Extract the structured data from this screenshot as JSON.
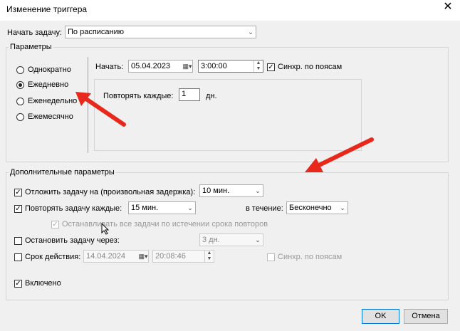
{
  "window": {
    "title": "Изменение триггера",
    "close_label": "✕"
  },
  "start_task": {
    "label": "Начать задачу:",
    "value": "По расписанию"
  },
  "params": {
    "group_label": "Параметры",
    "radios": [
      {
        "label": "Однократно",
        "selected": false
      },
      {
        "label": "Ежедневно",
        "selected": true
      },
      {
        "label": "Еженедельно",
        "selected": false
      },
      {
        "label": "Ежемесячно",
        "selected": false
      }
    ],
    "start_label": "Начать:",
    "start_date": "05.04.2023",
    "start_time": "3:00:00",
    "sync_label": "Синхр. по поясам",
    "repeat_label": "Повторять каждые:",
    "repeat_value": "1",
    "repeat_unit": "дн."
  },
  "advanced": {
    "group_label": "Дополнительные параметры",
    "delay_label": "Отложить задачу на (произвольная задержка):",
    "delay_value": "10 мин.",
    "repeat_label": "Повторять задачу каждые:",
    "repeat_value": "15 мин.",
    "duration_label": "в течение:",
    "duration_value": "Бесконечно",
    "stop_all_label": "Останавливать все задачи по истечении срока повторов",
    "stop_label": "Остановить задачу через:",
    "stop_value": "3 дн.",
    "expire_label": "Срок действия:",
    "expire_date": "14.04.2024",
    "expire_time": "20:08:46",
    "expire_sync_label": "Синхр. по поясам",
    "enabled_label": "Включено"
  },
  "buttons": {
    "ok": "OK",
    "cancel": "Отмена"
  },
  "colors": {
    "arrow": "#e8281b",
    "accent": "#0078d7"
  }
}
